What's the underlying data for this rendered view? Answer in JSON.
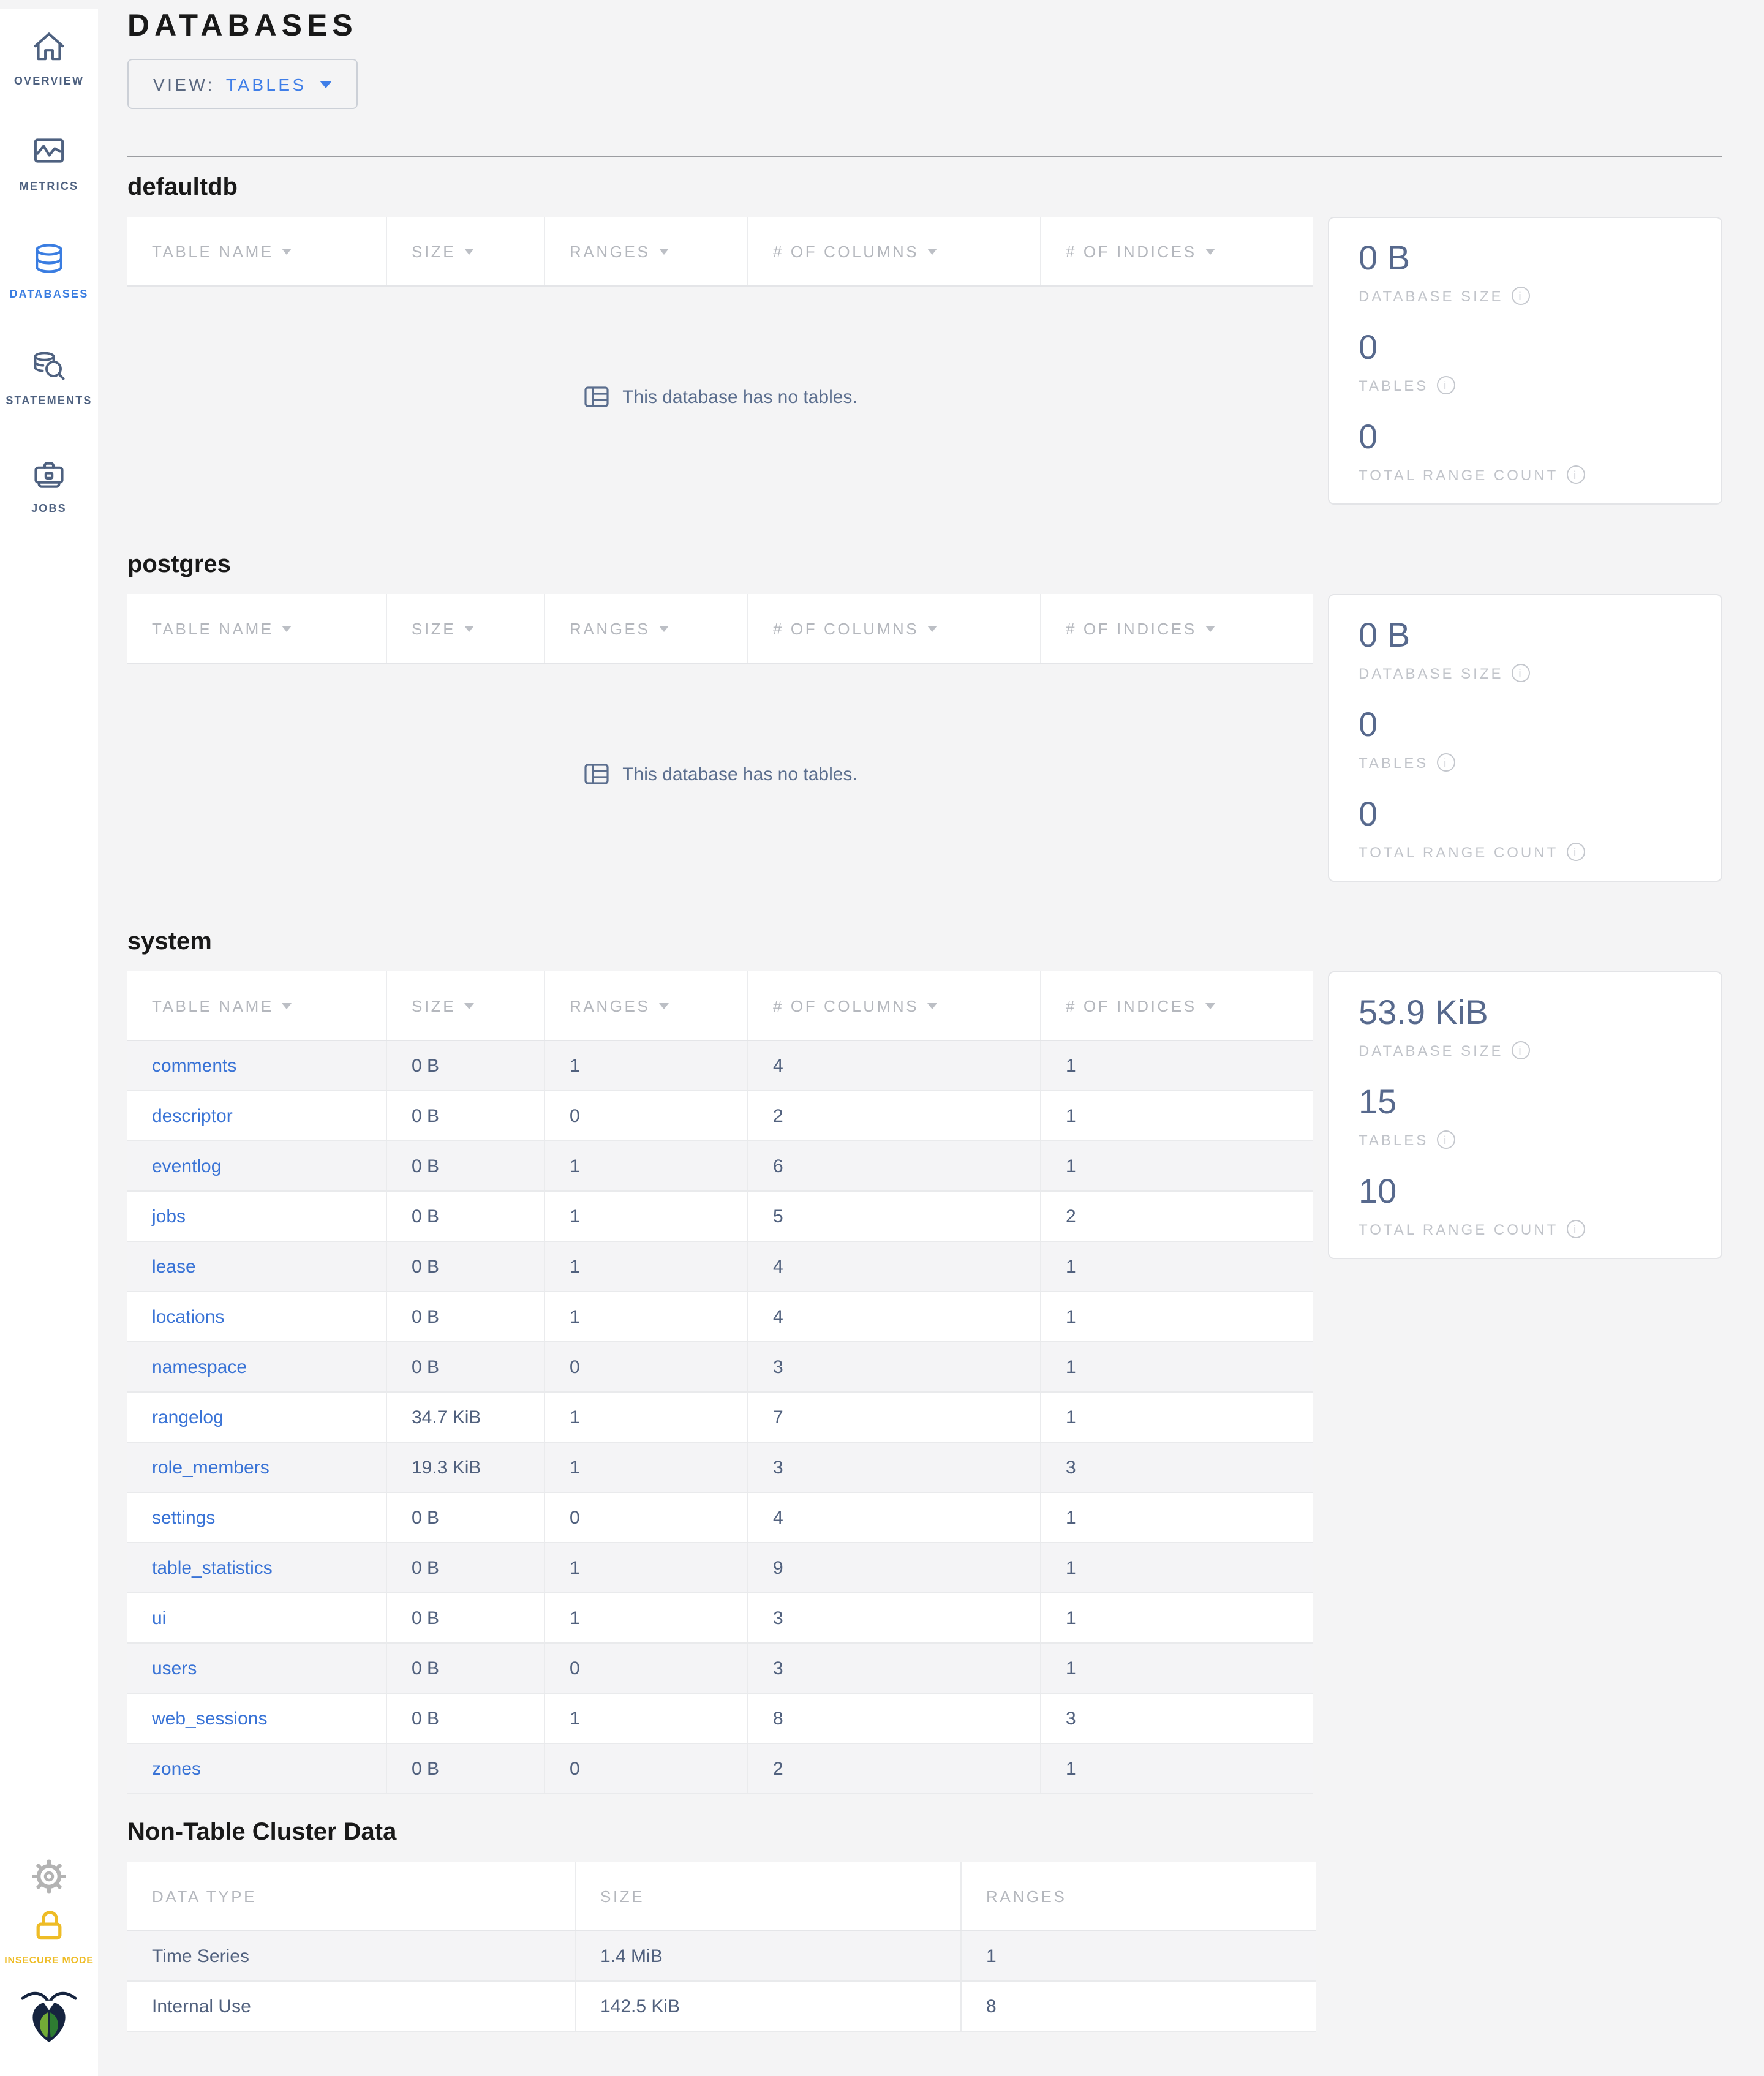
{
  "header": {
    "title": "DATABASES",
    "view_label": "VIEW:",
    "view_value": "TABLES"
  },
  "sidebar": {
    "items": [
      {
        "label": "OVERVIEW",
        "icon": "home-icon",
        "active": false
      },
      {
        "label": "METRICS",
        "icon": "metrics-icon",
        "active": false
      },
      {
        "label": "DATABASES",
        "icon": "database-icon",
        "active": true
      },
      {
        "label": "STATEMENTS",
        "icon": "statements-icon",
        "active": false
      },
      {
        "label": "JOBS",
        "icon": "jobs-icon",
        "active": false
      }
    ],
    "bottom_icons": [
      "gear-icon",
      "unlock-icon",
      "cockroach-logo"
    ],
    "insecure_label": "INSECURE MODE"
  },
  "table_headers": {
    "table_name": "TABLE NAME",
    "size": "SIZE",
    "ranges": "RANGES",
    "columns": "# OF COLUMNS",
    "indices": "# OF INDICES"
  },
  "empty_message": "This database has no tables.",
  "stats_labels": {
    "size": "DATABASE SIZE",
    "tables": "TABLES",
    "range_count": "TOTAL RANGE COUNT"
  },
  "databases": [
    {
      "name": "defaultdb",
      "empty": true,
      "stats": {
        "size": "0 B",
        "tables": "0",
        "range_count": "0"
      }
    },
    {
      "name": "postgres",
      "empty": true,
      "stats": {
        "size": "0 B",
        "tables": "0",
        "range_count": "0"
      }
    },
    {
      "name": "system",
      "empty": false,
      "stats": {
        "size": "53.9 KiB",
        "tables": "15",
        "range_count": "10"
      },
      "rows": [
        {
          "name": "comments",
          "size": "0 B",
          "ranges": "1",
          "columns": "4",
          "indices": "1"
        },
        {
          "name": "descriptor",
          "size": "0 B",
          "ranges": "0",
          "columns": "2",
          "indices": "1"
        },
        {
          "name": "eventlog",
          "size": "0 B",
          "ranges": "1",
          "columns": "6",
          "indices": "1"
        },
        {
          "name": "jobs",
          "size": "0 B",
          "ranges": "1",
          "columns": "5",
          "indices": "2"
        },
        {
          "name": "lease",
          "size": "0 B",
          "ranges": "1",
          "columns": "4",
          "indices": "1"
        },
        {
          "name": "locations",
          "size": "0 B",
          "ranges": "1",
          "columns": "4",
          "indices": "1"
        },
        {
          "name": "namespace",
          "size": "0 B",
          "ranges": "0",
          "columns": "3",
          "indices": "1"
        },
        {
          "name": "rangelog",
          "size": "34.7 KiB",
          "ranges": "1",
          "columns": "7",
          "indices": "1"
        },
        {
          "name": "role_members",
          "size": "19.3 KiB",
          "ranges": "1",
          "columns": "3",
          "indices": "3"
        },
        {
          "name": "settings",
          "size": "0 B",
          "ranges": "0",
          "columns": "4",
          "indices": "1"
        },
        {
          "name": "table_statistics",
          "size": "0 B",
          "ranges": "1",
          "columns": "9",
          "indices": "1"
        },
        {
          "name": "ui",
          "size": "0 B",
          "ranges": "1",
          "columns": "3",
          "indices": "1"
        },
        {
          "name": "users",
          "size": "0 B",
          "ranges": "0",
          "columns": "3",
          "indices": "1"
        },
        {
          "name": "web_sessions",
          "size": "0 B",
          "ranges": "1",
          "columns": "8",
          "indices": "3"
        },
        {
          "name": "zones",
          "size": "0 B",
          "ranges": "0",
          "columns": "2",
          "indices": "1"
        }
      ]
    }
  ],
  "non_table": {
    "title": "Non-Table Cluster Data",
    "headers": [
      "DATA TYPE",
      "SIZE",
      "RANGES"
    ],
    "rows": [
      {
        "type": "Time Series",
        "size": "1.4 MiB",
        "ranges": "1"
      },
      {
        "type": "Internal Use",
        "size": "142.5 KiB",
        "ranges": "8"
      }
    ]
  },
  "colors": {
    "accent_blue": "#3a7de1",
    "link_blue": "#3973d6",
    "slate_text": "#51617e",
    "stat_value": "#57698d",
    "muted_label": "#c1c4ca",
    "header_label": "#b4b7bd",
    "insecure_yellow": "#eebc26",
    "page_bg": "#f4f4f5",
    "panel_border": "#e3e4e7"
  }
}
